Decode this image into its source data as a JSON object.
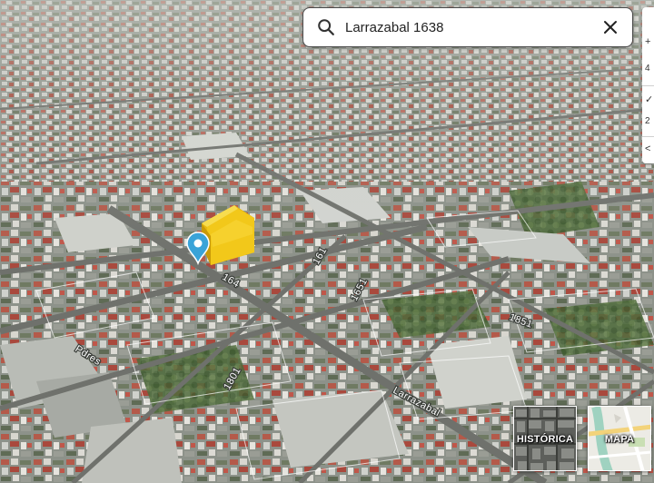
{
  "search": {
    "value": "Larrazabal 1638",
    "placeholder": ""
  },
  "map": {
    "street_labels": {
      "larrazabal": "Larrazabal",
      "left_avenue": "Pdres",
      "near_marker": "164",
      "lower_number": "1801",
      "mid_number": "1651",
      "right_number": "1851",
      "center_number": "161"
    },
    "marker_color": "#3aa3d8",
    "highlight_color": "#f2c81a"
  },
  "controls": {
    "zoom_in_glyph": "+",
    "zoom_level_text": "4",
    "tilt_glyph": "✓",
    "tilt_text": "2",
    "back_glyph": "<"
  },
  "basemaps": {
    "historic_label": "HISTÓRICA",
    "map_label": "MAPA"
  },
  "icons": {
    "search": "magnifier-icon",
    "clear": "close-icon",
    "marker": "map-pin-icon"
  }
}
